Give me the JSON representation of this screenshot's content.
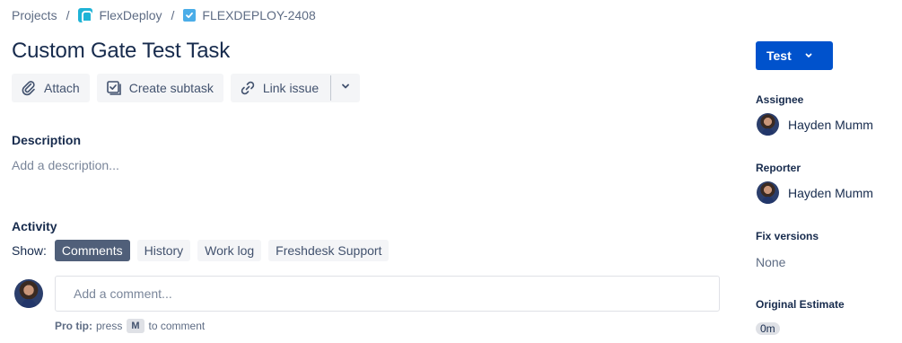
{
  "breadcrumb": {
    "projects": "Projects",
    "separator": "/",
    "project": "FlexDeploy",
    "project_icon": "project-avatar-icon",
    "issue_key": "FLEXDEPLOY-2408",
    "issue_icon": "task-type-icon"
  },
  "issue": {
    "title": "Custom Gate Test Task"
  },
  "toolbar": {
    "attach": "Attach",
    "create_subtask": "Create subtask",
    "link_issue": "Link issue"
  },
  "description": {
    "label": "Description",
    "placeholder": "Add a description..."
  },
  "activity": {
    "label": "Activity",
    "show_label": "Show:",
    "filters": [
      "Comments",
      "History",
      "Work log",
      "Freshdesk Support"
    ],
    "active_filter": "Comments"
  },
  "comment": {
    "placeholder": "Add a comment...",
    "protip_bold": "Pro tip:",
    "protip_pre": "press",
    "protip_key": "M",
    "protip_post": "to comment"
  },
  "sidebar": {
    "status": "Test",
    "assignee_label": "Assignee",
    "assignee_name": "Hayden Mumm",
    "reporter_label": "Reporter",
    "reporter_name": "Hayden Mumm",
    "fix_versions_label": "Fix versions",
    "fix_versions_value": "None",
    "original_estimate_label": "Original Estimate",
    "original_estimate_value": "0m"
  },
  "colors": {
    "primary": "#0052cc",
    "active_filter_bg": "#505f79",
    "button_bg": "#f4f5f7",
    "text": "#172b4d",
    "muted": "#5e6c84"
  }
}
